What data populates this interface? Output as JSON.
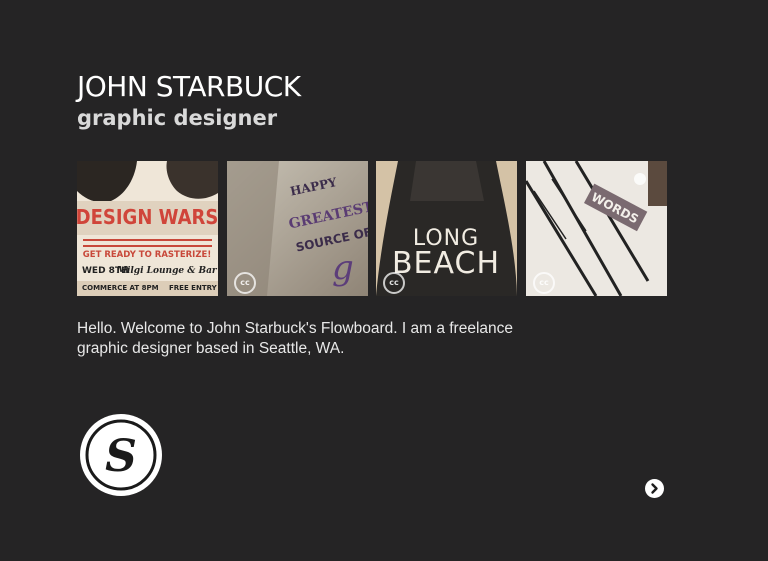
{
  "profile": {
    "name": "JOHN STARBUCK",
    "title": "graphic designer",
    "intro": "Hello. Welcome to John Starbuck's Flowboard. I am a freelance graphic designer based in Seattle, WA."
  },
  "gallery": [
    {
      "caption_lines": [
        "DESIGN WARS",
        "GET READY TO RASTERIZE!",
        "WED 8TH",
        "Milgi Lounge & Bar",
        "COMMERCE AT 8PM",
        "FREE ENTRY"
      ],
      "license": ""
    },
    {
      "caption_lines": [
        "HAPPY",
        "GREATEST",
        "SOURCE OF"
      ],
      "license": "cc"
    },
    {
      "caption_lines": [
        "LONG",
        "BEACH"
      ],
      "license": "cc"
    },
    {
      "caption_lines": [
        "WORDS"
      ],
      "license": "cc"
    }
  ],
  "logo": {
    "letter": "S"
  },
  "navigation": {
    "next_icon": "chevron-right-icon"
  },
  "colors": {
    "background": "#252425",
    "text": "#ffffff",
    "subtitle": "#d9d9d9"
  }
}
